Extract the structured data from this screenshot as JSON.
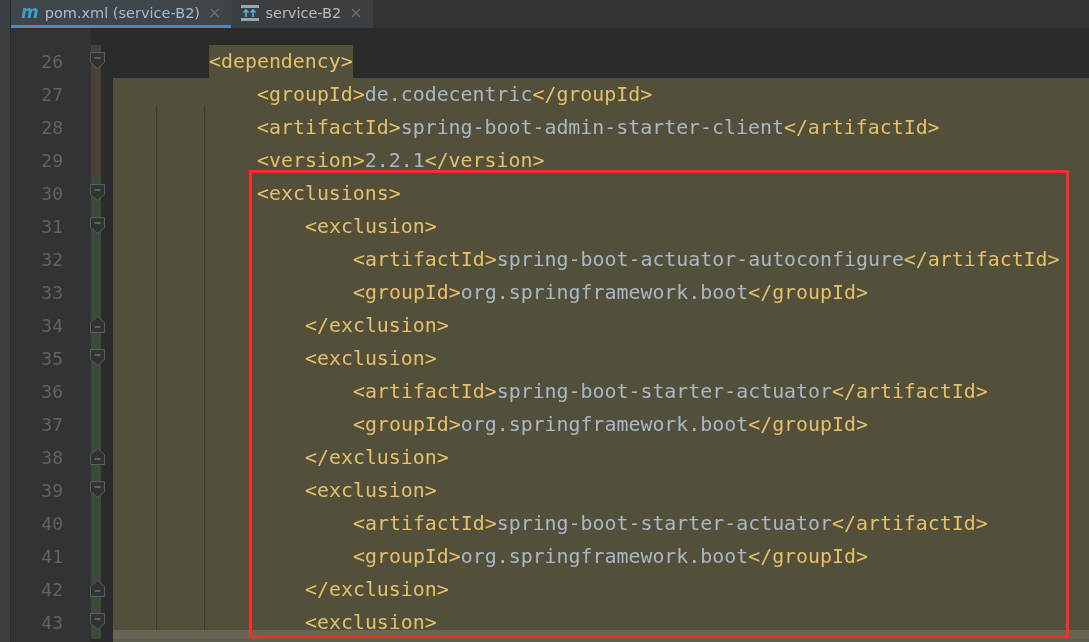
{
  "tabs": [
    {
      "icon_text": "m",
      "label": "pom.xml (service-B2)",
      "close": "×",
      "selected": true
    },
    {
      "label": "service-B2",
      "close": "×",
      "selected": false
    }
  ],
  "editor": {
    "lines": [
      {
        "number": "26",
        "kind": "modified",
        "fold_start": true,
        "fold_end": false,
        "selected": true,
        "selection_start": true,
        "segments": [
          {
            "kind": "tag",
            "text": "<dependency>"
          }
        ],
        "children": [
          {
            "number": "27",
            "kind": "modified",
            "fold_start": false,
            "fold_end": false,
            "selected": true,
            "selection_start": false,
            "segments": [
              {
                "kind": "tag",
                "text": "<groupId>"
              },
              {
                "kind": "text",
                "text": "de.codecentric"
              },
              {
                "kind": "tag",
                "text": "</groupId>"
              }
            ]
          },
          {
            "number": "28",
            "kind": "modified",
            "fold_start": false,
            "fold_end": false,
            "selected": true,
            "selection_start": false,
            "segments": [
              {
                "kind": "tag",
                "text": "<artifactId>"
              },
              {
                "kind": "text",
                "text": "spring-boot-admin-starter-client"
              },
              {
                "kind": "tag",
                "text": "</artifactId>"
              }
            ]
          },
          {
            "number": "29",
            "kind": "modified",
            "fold_start": false,
            "fold_end": false,
            "selected": true,
            "selection_start": false,
            "segments": [
              {
                "kind": "tag",
                "text": "<version>"
              },
              {
                "kind": "text",
                "text": "2.2.1"
              },
              {
                "kind": "tag",
                "text": "</version>"
              }
            ]
          },
          {
            "number": "30",
            "kind": "added",
            "fold_start": true,
            "fold_end": false,
            "selected": true,
            "selection_start": false,
            "segments": [
              {
                "kind": "tag",
                "text": "<exclusions>"
              }
            ],
            "children": [
              {
                "number": "31",
                "kind": "added",
                "fold_start": true,
                "fold_end": false,
                "selected": true,
                "selection_start": false,
                "segments": [
                  {
                    "kind": "tag",
                    "text": "<exclusion>"
                  }
                ],
                "children": [
                  {
                    "number": "32",
                    "kind": "added",
                    "fold_start": false,
                    "fold_end": false,
                    "selected": true,
                    "selection_start": false,
                    "segments": [
                      {
                        "kind": "tag",
                        "text": "<artifactId>"
                      },
                      {
                        "kind": "text",
                        "text": "spring-boot-actuator-autoconfigure"
                      },
                      {
                        "kind": "tag",
                        "text": "</artifactId>"
                      }
                    ]
                  },
                  {
                    "number": "33",
                    "kind": "added",
                    "fold_start": false,
                    "fold_end": false,
                    "selected": true,
                    "selection_start": false,
                    "segments": [
                      {
                        "kind": "tag",
                        "text": "<groupId>"
                      },
                      {
                        "kind": "text",
                        "text": "org.springframework.boot"
                      },
                      {
                        "kind": "tag",
                        "text": "</groupId>"
                      }
                    ]
                  }
                ]
              },
              {
                "number": "34",
                "kind": "added",
                "fold_start": false,
                "fold_end": true,
                "selected": true,
                "selection_start": false,
                "segments": [
                  {
                    "kind": "tag",
                    "text": "</exclusion>"
                  }
                ]
              },
              {
                "number": "35",
                "kind": "added",
                "fold_start": true,
                "fold_end": false,
                "selected": true,
                "selection_start": false,
                "segments": [
                  {
                    "kind": "tag",
                    "text": "<exclusion>"
                  }
                ],
                "children": [
                  {
                    "number": "36",
                    "kind": "added",
                    "fold_start": false,
                    "fold_end": false,
                    "selected": true,
                    "selection_start": false,
                    "segments": [
                      {
                        "kind": "tag",
                        "text": "<artifactId>"
                      },
                      {
                        "kind": "text",
                        "text": "spring-boot-starter-actuator"
                      },
                      {
                        "kind": "tag",
                        "text": "</artifactId>"
                      }
                    ]
                  },
                  {
                    "number": "37",
                    "kind": "added",
                    "fold_start": false,
                    "fold_end": false,
                    "selected": true,
                    "selection_start": false,
                    "segments": [
                      {
                        "kind": "tag",
                        "text": "<groupId>"
                      },
                      {
                        "kind": "text",
                        "text": "org.springframework.boot"
                      },
                      {
                        "kind": "tag",
                        "text": "</groupId>"
                      }
                    ]
                  }
                ]
              },
              {
                "number": "38",
                "kind": "added",
                "fold_start": false,
                "fold_end": true,
                "selected": true,
                "selection_start": false,
                "segments": [
                  {
                    "kind": "tag",
                    "text": "</exclusion>"
                  }
                ]
              },
              {
                "number": "39",
                "kind": "added",
                "fold_start": true,
                "fold_end": false,
                "selected": true,
                "selection_start": false,
                "segments": [
                  {
                    "kind": "tag",
                    "text": "<exclusion>"
                  }
                ],
                "children": [
                  {
                    "number": "40",
                    "kind": "added",
                    "fold_start": false,
                    "fold_end": false,
                    "selected": true,
                    "selection_start": false,
                    "segments": [
                      {
                        "kind": "tag",
                        "text": "<artifactId>"
                      },
                      {
                        "kind": "text",
                        "text": "spring-boot-starter-actuator"
                      },
                      {
                        "kind": "tag",
                        "text": "</artifactId>"
                      }
                    ]
                  },
                  {
                    "number": "41",
                    "kind": "added",
                    "fold_start": false,
                    "fold_end": false,
                    "selected": true,
                    "selection_start": false,
                    "segments": [
                      {
                        "kind": "tag",
                        "text": "<groupId>"
                      },
                      {
                        "kind": "text",
                        "text": "org.springframework.boot"
                      },
                      {
                        "kind": "tag",
                        "text": "</groupId>"
                      }
                    ]
                  }
                ]
              },
              {
                "number": "42",
                "kind": "added",
                "fold_start": false,
                "fold_end": true,
                "selected": true,
                "selection_start": false,
                "segments": [
                  {
                    "kind": "tag",
                    "text": "</exclusion>"
                  }
                ]
              },
              {
                "number": "43",
                "kind": "added",
                "fold_start": true,
                "fold_end": false,
                "selected": true,
                "selection_start": false,
                "segments": [
                  {
                    "kind": "tag",
                    "text": "<exclusion>"
                  }
                ]
              }
            ]
          }
        ]
      }
    ]
  }
}
